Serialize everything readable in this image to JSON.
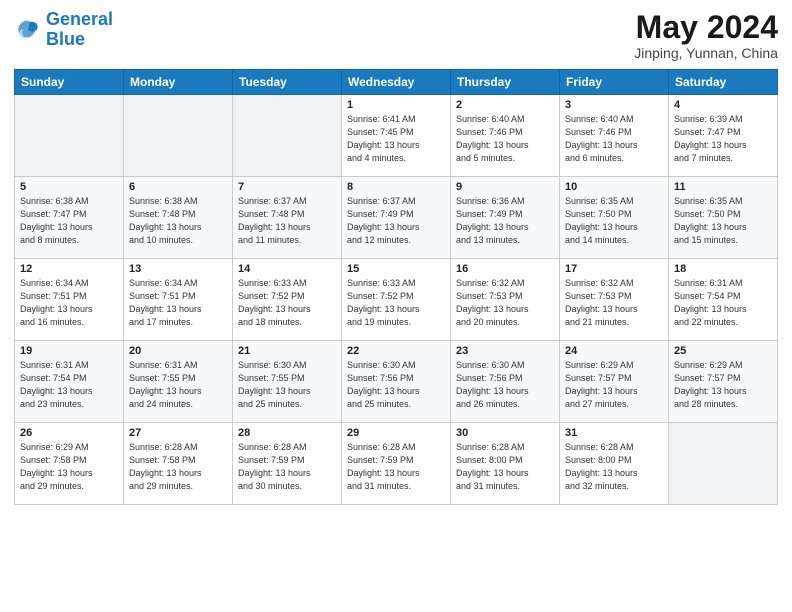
{
  "header": {
    "logo_line1": "General",
    "logo_line2": "Blue",
    "month": "May 2024",
    "location": "Jinping, Yunnan, China"
  },
  "weekdays": [
    "Sunday",
    "Monday",
    "Tuesday",
    "Wednesday",
    "Thursday",
    "Friday",
    "Saturday"
  ],
  "weeks": [
    [
      {
        "day": "",
        "info": ""
      },
      {
        "day": "",
        "info": ""
      },
      {
        "day": "",
        "info": ""
      },
      {
        "day": "1",
        "info": "Sunrise: 6:41 AM\nSunset: 7:45 PM\nDaylight: 13 hours\nand 4 minutes."
      },
      {
        "day": "2",
        "info": "Sunrise: 6:40 AM\nSunset: 7:46 PM\nDaylight: 13 hours\nand 5 minutes."
      },
      {
        "day": "3",
        "info": "Sunrise: 6:40 AM\nSunset: 7:46 PM\nDaylight: 13 hours\nand 6 minutes."
      },
      {
        "day": "4",
        "info": "Sunrise: 6:39 AM\nSunset: 7:47 PM\nDaylight: 13 hours\nand 7 minutes."
      }
    ],
    [
      {
        "day": "5",
        "info": "Sunrise: 6:38 AM\nSunset: 7:47 PM\nDaylight: 13 hours\nand 8 minutes."
      },
      {
        "day": "6",
        "info": "Sunrise: 6:38 AM\nSunset: 7:48 PM\nDaylight: 13 hours\nand 10 minutes."
      },
      {
        "day": "7",
        "info": "Sunrise: 6:37 AM\nSunset: 7:48 PM\nDaylight: 13 hours\nand 11 minutes."
      },
      {
        "day": "8",
        "info": "Sunrise: 6:37 AM\nSunset: 7:49 PM\nDaylight: 13 hours\nand 12 minutes."
      },
      {
        "day": "9",
        "info": "Sunrise: 6:36 AM\nSunset: 7:49 PM\nDaylight: 13 hours\nand 13 minutes."
      },
      {
        "day": "10",
        "info": "Sunrise: 6:35 AM\nSunset: 7:50 PM\nDaylight: 13 hours\nand 14 minutes."
      },
      {
        "day": "11",
        "info": "Sunrise: 6:35 AM\nSunset: 7:50 PM\nDaylight: 13 hours\nand 15 minutes."
      }
    ],
    [
      {
        "day": "12",
        "info": "Sunrise: 6:34 AM\nSunset: 7:51 PM\nDaylight: 13 hours\nand 16 minutes."
      },
      {
        "day": "13",
        "info": "Sunrise: 6:34 AM\nSunset: 7:51 PM\nDaylight: 13 hours\nand 17 minutes."
      },
      {
        "day": "14",
        "info": "Sunrise: 6:33 AM\nSunset: 7:52 PM\nDaylight: 13 hours\nand 18 minutes."
      },
      {
        "day": "15",
        "info": "Sunrise: 6:33 AM\nSunset: 7:52 PM\nDaylight: 13 hours\nand 19 minutes."
      },
      {
        "day": "16",
        "info": "Sunrise: 6:32 AM\nSunset: 7:53 PM\nDaylight: 13 hours\nand 20 minutes."
      },
      {
        "day": "17",
        "info": "Sunrise: 6:32 AM\nSunset: 7:53 PM\nDaylight: 13 hours\nand 21 minutes."
      },
      {
        "day": "18",
        "info": "Sunrise: 6:31 AM\nSunset: 7:54 PM\nDaylight: 13 hours\nand 22 minutes."
      }
    ],
    [
      {
        "day": "19",
        "info": "Sunrise: 6:31 AM\nSunset: 7:54 PM\nDaylight: 13 hours\nand 23 minutes."
      },
      {
        "day": "20",
        "info": "Sunrise: 6:31 AM\nSunset: 7:55 PM\nDaylight: 13 hours\nand 24 minutes."
      },
      {
        "day": "21",
        "info": "Sunrise: 6:30 AM\nSunset: 7:55 PM\nDaylight: 13 hours\nand 25 minutes."
      },
      {
        "day": "22",
        "info": "Sunrise: 6:30 AM\nSunset: 7:56 PM\nDaylight: 13 hours\nand 25 minutes."
      },
      {
        "day": "23",
        "info": "Sunrise: 6:30 AM\nSunset: 7:56 PM\nDaylight: 13 hours\nand 26 minutes."
      },
      {
        "day": "24",
        "info": "Sunrise: 6:29 AM\nSunset: 7:57 PM\nDaylight: 13 hours\nand 27 minutes."
      },
      {
        "day": "25",
        "info": "Sunrise: 6:29 AM\nSunset: 7:57 PM\nDaylight: 13 hours\nand 28 minutes."
      }
    ],
    [
      {
        "day": "26",
        "info": "Sunrise: 6:29 AM\nSunset: 7:58 PM\nDaylight: 13 hours\nand 29 minutes."
      },
      {
        "day": "27",
        "info": "Sunrise: 6:28 AM\nSunset: 7:58 PM\nDaylight: 13 hours\nand 29 minutes."
      },
      {
        "day": "28",
        "info": "Sunrise: 6:28 AM\nSunset: 7:59 PM\nDaylight: 13 hours\nand 30 minutes."
      },
      {
        "day": "29",
        "info": "Sunrise: 6:28 AM\nSunset: 7:59 PM\nDaylight: 13 hours\nand 31 minutes."
      },
      {
        "day": "30",
        "info": "Sunrise: 6:28 AM\nSunset: 8:00 PM\nDaylight: 13 hours\nand 31 minutes."
      },
      {
        "day": "31",
        "info": "Sunrise: 6:28 AM\nSunset: 8:00 PM\nDaylight: 13 hours\nand 32 minutes."
      },
      {
        "day": "",
        "info": ""
      }
    ]
  ]
}
